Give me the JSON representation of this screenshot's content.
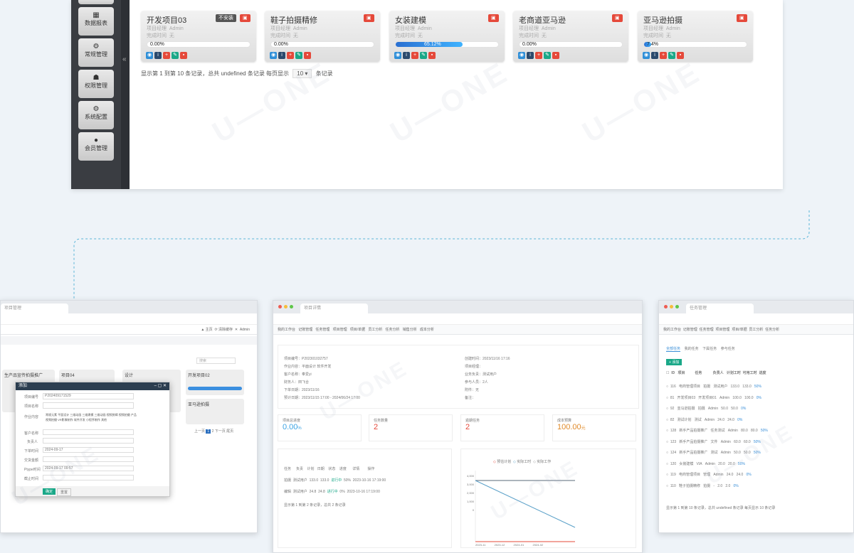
{
  "sidebar": {
    "items": [
      {
        "label": "数据报表",
        "icon": "chart-icon"
      },
      {
        "label": "常规管理",
        "icon": "gears-icon"
      },
      {
        "label": "权限管理",
        "icon": "users-icon"
      },
      {
        "label": "系统配置",
        "icon": "gears-icon"
      },
      {
        "label": "会员管理",
        "icon": "user-icon"
      }
    ],
    "collapse": "«"
  },
  "projects": [
    {
      "title": "开发项目03",
      "manager_label": "项目经理",
      "manager": "Admin",
      "finish_label": "完成时间",
      "finish": "无",
      "progress": "0.00%",
      "badges": [
        "不安装",
        "▣"
      ]
    },
    {
      "title": "鞋子拍摄精修",
      "manager_label": "项目经理",
      "manager": "Admin",
      "finish_label": "完成时间",
      "finish": "无",
      "progress": "0.00%",
      "badges": [
        "▣"
      ]
    },
    {
      "title": "女装建模",
      "manager_label": "项目经理",
      "manager": "Admin",
      "finish_label": "完成时间",
      "finish": "无",
      "progress": "65.12%",
      "badges": [
        "▣"
      ]
    },
    {
      "title": "老商道亚马逊",
      "manager_label": "项目经理",
      "manager": "Admin",
      "finish_label": "完成时间",
      "finish": "无",
      "progress": "0.00%",
      "badges": [
        "▣"
      ]
    },
    {
      "title": "亚马逊拍摄",
      "manager_label": "项目经理",
      "manager": "Admin",
      "finish_label": "完成时间",
      "finish": "无",
      "progress": "7.4%",
      "badges": [
        "▣"
      ]
    }
  ],
  "pager": {
    "text_before": "显示第 1 到第 10 条记录，总共 undefined 条记录 每页显示",
    "page_size": "10",
    "text_after": "条记录"
  },
  "watermark": "U—ONE",
  "win_left": {
    "tab": "项目管理",
    "nav": [
      "▲ 主页",
      "⟳ 清除缓存",
      "✕",
      "Admin"
    ],
    "dialog": {
      "title": "添加",
      "fields": [
        "项目编号",
        "项目名称",
        "作业内容",
        "客户名称",
        "负责人",
        "下单时间",
        "交货金额",
        "Ptype时间",
        "截止时间"
      ],
      "code": "P202409171529",
      "checks": [
        "常规元素",
        "平面设计",
        "三维动画",
        "三维建模",
        "三维动画",
        "视频剪辑",
        "视频拍摄",
        "产品视频拍摄",
        "VR影像制作",
        "软件开发",
        "小程序制作",
        "其他"
      ],
      "date1": "2024-09-17",
      "date2": "2024-09-17 09:57",
      "ok": "确定",
      "cancel": "重置"
    },
    "cards": [
      {
        "title": "生产品宣传拍摄推广"
      },
      {
        "title": "项目04"
      },
      {
        "title": "设计"
      },
      {
        "title": "开发项目02"
      },
      {
        "title": "亚马逊拍摄"
      }
    ],
    "search": "搜索",
    "pages": [
      "上一页",
      "1",
      "2",
      "下一页",
      "尾页"
    ]
  },
  "win_mid": {
    "tab": "项目详情",
    "nav": [
      "我的工作台",
      "记账管理",
      "任务管理",
      "项目管理",
      "项目/单据",
      "员工分析",
      "任务分析",
      "销售分析",
      "成本分析"
    ],
    "info_left": [
      "项目编号：P202301032757",
      "作业内容：平面设计 软件开发",
      "客户名称：奉爱yi",
      "财务人：田飞合",
      "下单日期：2023/11/16",
      "预计日期：2023/11/15 17:00 - 2024/06/24 17:00",
      "创建时间：2023/02/05 17:05"
    ],
    "info_right": [
      "创建时间：2023/11/16 17:16",
      "项目经理：",
      "业务负责：测试用户",
      "参与人员：2人",
      "附件：无",
      "备注："
    ],
    "stats": [
      {
        "label": "项目总进度",
        "value": "0.00",
        "unit": "%"
      },
      {
        "label": "任务数量",
        "value": "2",
        "unit": ""
      },
      {
        "label": "逾期任务",
        "value": "2",
        "unit": ""
      },
      {
        "label": "成本预算",
        "value": "100.00",
        "unit": "元"
      }
    ],
    "table_head": [
      "任务",
      "负责",
      "计划",
      "日期",
      "状态",
      "进度",
      "详情",
      "操作"
    ],
    "rows": [
      [
        "拍摄",
        "测试用户",
        "133.0",
        "133.0",
        "进行中",
        "50%",
        "2023-10-16 17:19:00"
      ],
      [
        "编辑",
        "测试用户",
        "24.8",
        "24.8",
        "进行中",
        "0%",
        "2023-10-16 17:19:00"
      ]
    ],
    "table_foot": "显示第 1 到第 2 条记录，总共 2 条记录",
    "chart": {
      "legend": [
        "预估计划",
        "实际工时",
        "实际工作"
      ],
      "yticks": [
        "4,000",
        "3,500",
        "3,000",
        "2,500",
        "2,000",
        "1,500",
        "1,000",
        "500",
        "0"
      ],
      "xticks": [
        "2023-11",
        "2023-12",
        "2024-01",
        "2024-02"
      ]
    }
  },
  "win_right": {
    "tab": "任务管理",
    "nav": [
      "我的工作台",
      "记账管理",
      "任务管理",
      "项目管理",
      "项目/单据",
      "员工分析",
      "任务分析"
    ],
    "tabs": [
      "全部任务",
      "我的任务",
      "下属任务",
      "参与任务"
    ],
    "add": "添加",
    "head": [
      "ID",
      "项目",
      "任务",
      "负责人",
      "计划工时",
      "可用工时",
      "进度",
      "状态"
    ],
    "rows": [
      [
        "116",
        "电商管理项目",
        "拍摄",
        "测试用户",
        "133.0",
        "133.0",
        "50%"
      ],
      [
        "81",
        "开发项目03",
        "开发项目01",
        "Admin",
        "100.0",
        "100.0",
        "0%"
      ],
      [
        "92",
        "亚马逊拍摄",
        "拍摄",
        "Admin",
        "50.0",
        "50.0",
        "0%"
      ],
      [
        "82",
        "测试计划",
        "测试",
        "Admin",
        "24.0",
        "24.0",
        "0%"
      ],
      [
        "128",
        "新手产品拍摄推广",
        "任务测试",
        "Admin",
        "80.0",
        "80.0",
        "50%"
      ],
      [
        "123",
        "新手产品拍摄推广",
        "文件",
        "Admin",
        "60.0",
        "60.0",
        "50%"
      ],
      [
        "124",
        "新手产品拍摄推广",
        "测试",
        "Admin",
        "50.0",
        "50.0",
        "50%"
      ],
      [
        "120",
        "女装建模",
        "VIA",
        "Admin",
        "20.0",
        "20.0",
        "50%"
      ],
      [
        "119",
        "电商管理项目",
        "管理",
        "Admin",
        "24.0",
        "24.0",
        "0%"
      ],
      [
        "110",
        "鞋子拍摄精修",
        "拍摄",
        "-",
        "2.0",
        "2.0",
        "0%"
      ]
    ],
    "foot": "显示第 1 到第 10 条记录，总共 undefined 条记录 每页显示 10 条记录"
  }
}
